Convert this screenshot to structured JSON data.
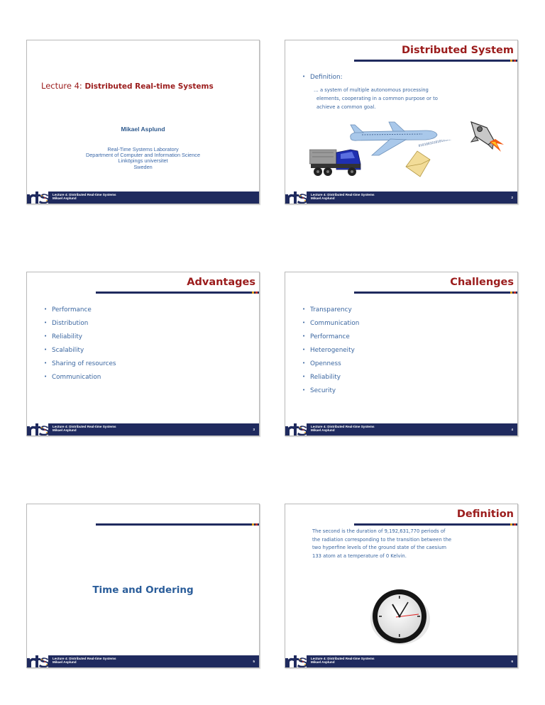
{
  "footer": {
    "line1": "Lecture 4: Distributed Real-time Systems",
    "line2": "Mikael Asplund",
    "logo": "rts-logo"
  },
  "slides": [
    {
      "page": "",
      "title_prefix": "Lecture 4:",
      "title_main": "Distributed Real-time Systems",
      "author": "Mikael Asplund",
      "affiliation": [
        "Real-Time Systems Laboratory",
        "Department of Computer and Information Science",
        "Linköpings universitet",
        "Sweden"
      ]
    },
    {
      "page": "2",
      "title": "Distributed System",
      "bullet": "Definition:",
      "quote_lines": [
        "… a system of multiple autonomous processing",
        "elements, cooperating in a common purpose or to",
        "achieve a common goal."
      ],
      "images": [
        "truck-image",
        "airplane-image",
        "envelope-binary-image",
        "rocket-image"
      ],
      "binary_stream": "0101001010101010100"
    },
    {
      "page": "3",
      "title": "Advantages",
      "bullets": [
        "Performance",
        "Distribution",
        "Reliability",
        "Scalability",
        "Sharing of resources",
        "Communication"
      ]
    },
    {
      "page": "4",
      "title": "Challenges",
      "bullets": [
        "Transparency",
        "Communication",
        "Performance",
        "Heterogeneity",
        "Openness",
        "Reliability",
        "Security"
      ]
    },
    {
      "page": "5",
      "section_title": "Time and Ordering"
    },
    {
      "page": "6",
      "title": "Definition",
      "text_lines": [
        "The second is the duration of 9,192,631,770 periods of",
        "the radiation corresponding to the transition between the",
        "two hyperfine levels of the ground state of the caesium",
        "133 atom at a temperature of 0 Kelvin."
      ],
      "image": "clock-image"
    }
  ],
  "colors": {
    "title_red": "#9b1c1c",
    "text_blue": "#3a66a0",
    "navy": "#1f2a5e",
    "accent_yellow": "#e0a020",
    "accent_red": "#c0302a"
  }
}
